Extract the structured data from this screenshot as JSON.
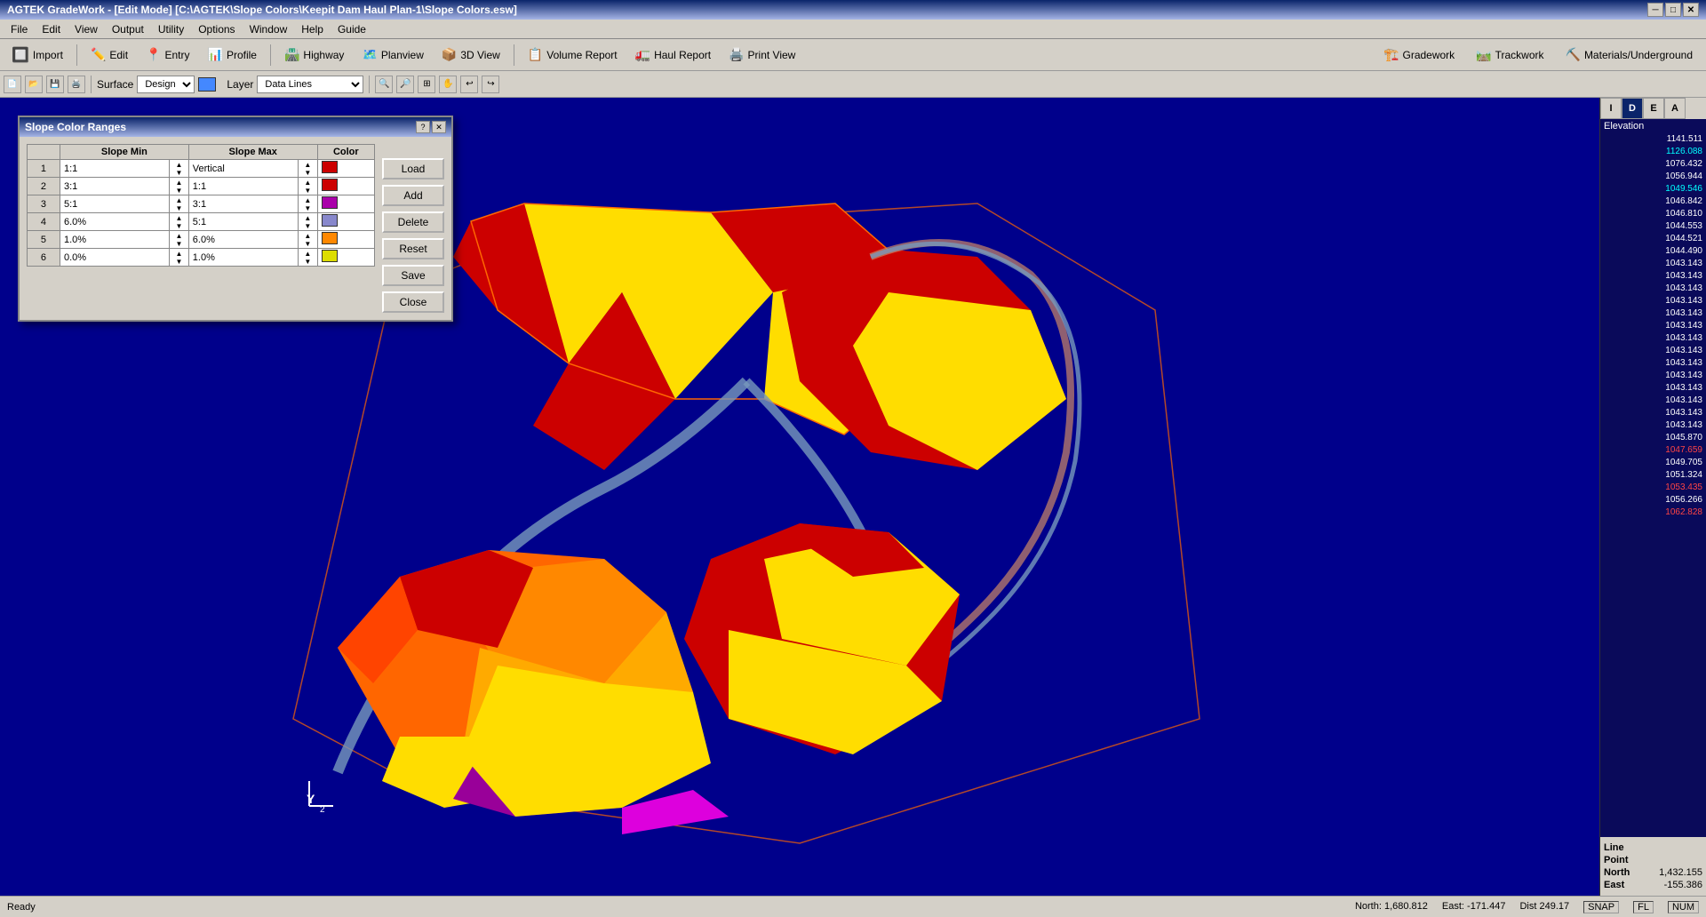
{
  "titleBar": {
    "title": "AGTEK GradeWork - [Edit Mode] [C:\\AGTEK\\Slope Colors\\Keepit Dam Haul Plan-1\\Slope Colors.esw]",
    "minimize": "─",
    "restore": "□",
    "close": "✕"
  },
  "menuBar": {
    "items": [
      "File",
      "Edit",
      "View",
      "Output",
      "Utility",
      "Options",
      "Window",
      "Help",
      "Guide"
    ]
  },
  "toolbar1": {
    "buttons": [
      {
        "label": "Import",
        "icon": "import"
      },
      {
        "label": "Edit",
        "icon": "edit"
      },
      {
        "label": "Entry",
        "icon": "entry"
      },
      {
        "label": "Profile",
        "icon": "profile"
      },
      {
        "label": "Highway",
        "icon": "highway"
      },
      {
        "label": "Planview",
        "icon": "planview"
      },
      {
        "label": "3D View",
        "icon": "3dview"
      },
      {
        "label": "Volume Report",
        "icon": "volume"
      },
      {
        "label": "Haul Report",
        "icon": "haul"
      },
      {
        "label": "Print View",
        "icon": "print"
      }
    ],
    "rightButtons": [
      {
        "label": "Gradework",
        "icon": "gradework"
      },
      {
        "label": "Trackwork",
        "icon": "trackwork"
      },
      {
        "label": "Materials/Underground",
        "icon": "materials"
      }
    ]
  },
  "toolbar2": {
    "surfaceLabel": "Surface",
    "surfaceValue": "Design",
    "layerLabel": "Layer",
    "layerValue": "Data Lines"
  },
  "rightPanel": {
    "tabs": [
      "I",
      "D",
      "E",
      "A"
    ],
    "elevationHeader": "Elevation",
    "elevations": [
      {
        "value": "1141.511",
        "color": "white"
      },
      {
        "value": "1126.088",
        "color": "cyan"
      },
      {
        "value": "1076.432",
        "color": "white"
      },
      {
        "value": "1056.944",
        "color": "white"
      },
      {
        "value": "1049.546",
        "color": "cyan"
      },
      {
        "value": "1046.842",
        "color": "white"
      },
      {
        "value": "1046.810",
        "color": "white"
      },
      {
        "value": "1044.553",
        "color": "white"
      },
      {
        "value": "1044.521",
        "color": "white"
      },
      {
        "value": "1044.490",
        "color": "white"
      },
      {
        "value": "1043.143",
        "color": "white"
      },
      {
        "value": "1043.143",
        "color": "white"
      },
      {
        "value": "1043.143",
        "color": "white"
      },
      {
        "value": "1043.143",
        "color": "white"
      },
      {
        "value": "1043.143",
        "color": "white"
      },
      {
        "value": "1043.143",
        "color": "white"
      },
      {
        "value": "1043.143",
        "color": "white"
      },
      {
        "value": "1043.143",
        "color": "white"
      },
      {
        "value": "1043.143",
        "color": "white"
      },
      {
        "value": "1043.143",
        "color": "white"
      },
      {
        "value": "1043.143",
        "color": "white"
      },
      {
        "value": "1043.143",
        "color": "white"
      },
      {
        "value": "1043.143",
        "color": "white"
      },
      {
        "value": "1043.143",
        "color": "white"
      },
      {
        "value": "1045.870",
        "color": "white"
      },
      {
        "value": "1047.659",
        "color": "red"
      },
      {
        "value": "1049.705",
        "color": "white"
      },
      {
        "value": "1051.324",
        "color": "white"
      },
      {
        "value": "1053.435",
        "color": "red"
      },
      {
        "value": "1056.266",
        "color": "white"
      },
      {
        "value": "1062.828",
        "color": "red"
      }
    ],
    "lineLabel": "Line",
    "lineValue": "",
    "pointLabel": "Point",
    "pointValue": "",
    "northLabel": "North",
    "northValue": "1,432.155",
    "eastLabel": "East",
    "eastValue": "-155.386"
  },
  "statusBar": {
    "ready": "Ready",
    "north": "North: 1,680.812",
    "east": "East: -171.447",
    "dist": "Dist 249.17",
    "snap": "SNAP",
    "fl": "FL",
    "num": "NUM"
  },
  "dialog": {
    "title": "Slope Color Ranges",
    "helpBtn": "?",
    "closeBtn": "✕",
    "columns": [
      "",
      "Slope Min",
      "",
      "Slope Max",
      "",
      "Color"
    ],
    "rows": [
      {
        "num": 1,
        "slopeMin": "1:1",
        "slopeMax": "Vertical",
        "color": "#cc0000"
      },
      {
        "num": 2,
        "slopeMin": "3:1",
        "slopeMax": "1:1",
        "color": "#cc0000"
      },
      {
        "num": 3,
        "slopeMin": "5:1",
        "slopeMax": "3:1",
        "color": "#aa00aa"
      },
      {
        "num": 4,
        "slopeMin": "6.0%",
        "slopeMax": "5:1",
        "color": "#8888cc"
      },
      {
        "num": 5,
        "slopeMin": "1.0%",
        "slopeMax": "6.0%",
        "color": "#ff8800"
      },
      {
        "num": 6,
        "slopeMin": "0.0%",
        "slopeMax": "1.0%",
        "color": "#dddd00"
      }
    ],
    "buttons": [
      "Load",
      "Add",
      "Delete",
      "Reset",
      "Save",
      "Close"
    ]
  }
}
